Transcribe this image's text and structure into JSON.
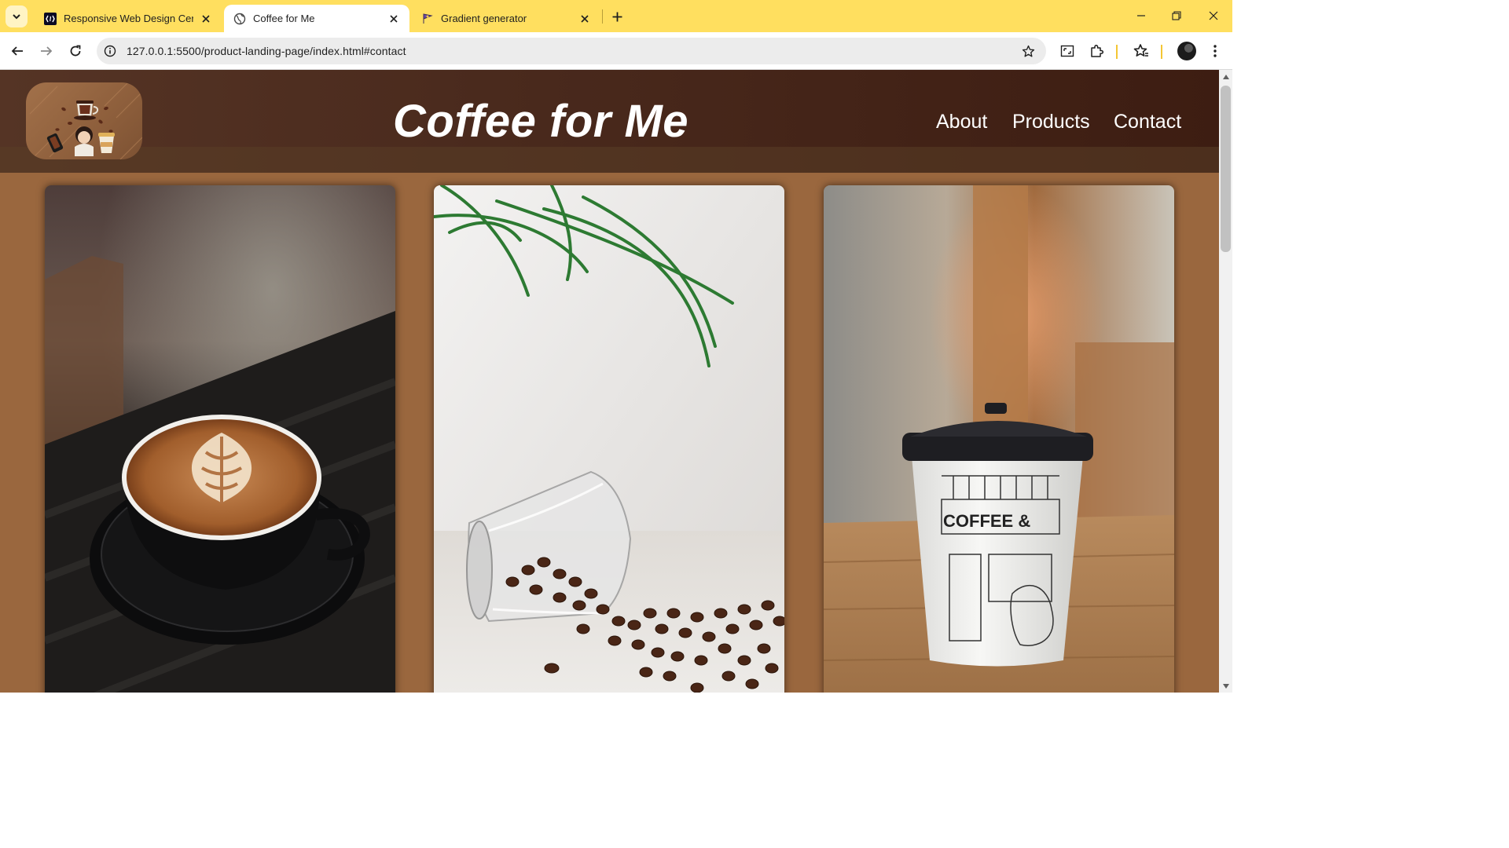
{
  "browser": {
    "tabs": [
      {
        "title": "Responsive Web Design Certific",
        "favicon": "freecodecamp-icon",
        "active": false
      },
      {
        "title": "Coffee for Me",
        "favicon": "globe-icon",
        "active": true
      },
      {
        "title": "Gradient generator",
        "favicon": "gradient-generator-icon",
        "active": false
      }
    ],
    "address_bar": {
      "url": "127.0.0.1:5500/product-landing-page/index.html#contact"
    },
    "colors": {
      "tab_strip": "#ffdf5f",
      "toolbar": "#ffffff",
      "omnibox": "#ececec"
    }
  },
  "site": {
    "title": "Coffee for Me",
    "logo": "coffee-illustration-logo",
    "nav": [
      {
        "label": "About"
      },
      {
        "label": "Products"
      },
      {
        "label": "Contact"
      }
    ],
    "cards": [
      {
        "image": "latte-art-cup-photo"
      },
      {
        "image": "spilled-coffee-beans-glass-photo"
      },
      {
        "image": "paper-coffee-cup-photo"
      }
    ],
    "colors": {
      "header_dark": "#3d1d12",
      "header_light": "#553425",
      "page_background": "#9a673e",
      "text": "#ffffff"
    }
  }
}
